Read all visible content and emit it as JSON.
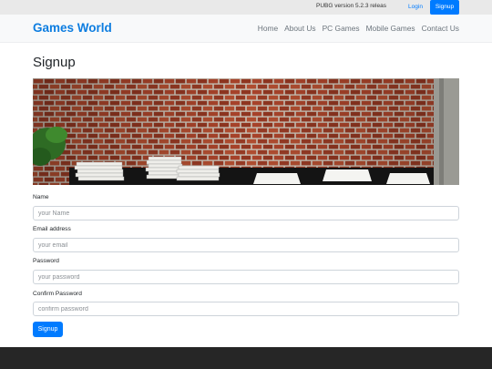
{
  "topbar": {
    "news": "PUBG version 5.2.3 releas",
    "login_label": "Login",
    "signup_label": "Signup"
  },
  "navbar": {
    "brand": "Games World",
    "links": [
      "Home",
      "About Us",
      "PC Games",
      "Mobile Games",
      "Contact Us"
    ]
  },
  "page": {
    "title": "Signup"
  },
  "form": {
    "name_label": "Name",
    "name_placeholder": "your Name",
    "email_label": "Email address",
    "email_placeholder": "your email",
    "password_label": "Password",
    "password_placeholder": "your password",
    "confirm_label": "Confirm Password",
    "confirm_placeholder": "confirm password",
    "submit_label": "Signup"
  },
  "colors": {
    "accent": "#007bff",
    "brand": "#0d7de0",
    "footer": "#262626"
  }
}
